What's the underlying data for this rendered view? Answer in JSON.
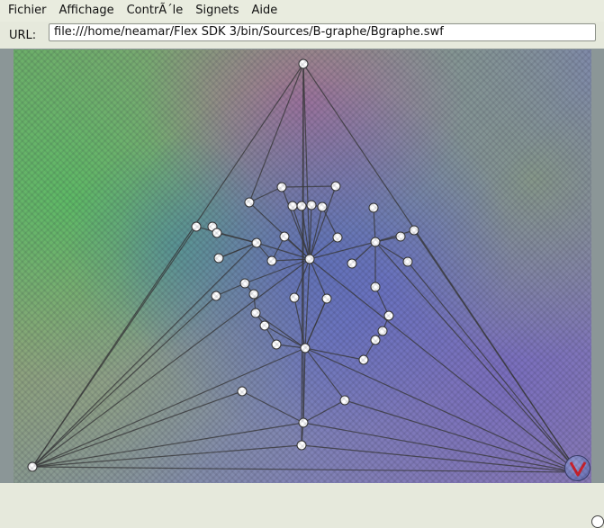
{
  "menubar": {
    "items": [
      "Fichier",
      "Affichage",
      "ContrÃ´le",
      "Signets",
      "Aide"
    ]
  },
  "urlbar": {
    "label": "URL:",
    "value": "file:///home/neamar/Flex SDK 3/bin/Sources/B-graphe/Bgraphe.swf"
  },
  "stage": {
    "badge_icon": "v-logo-icon",
    "badge_color": "#d0202a"
  }
}
